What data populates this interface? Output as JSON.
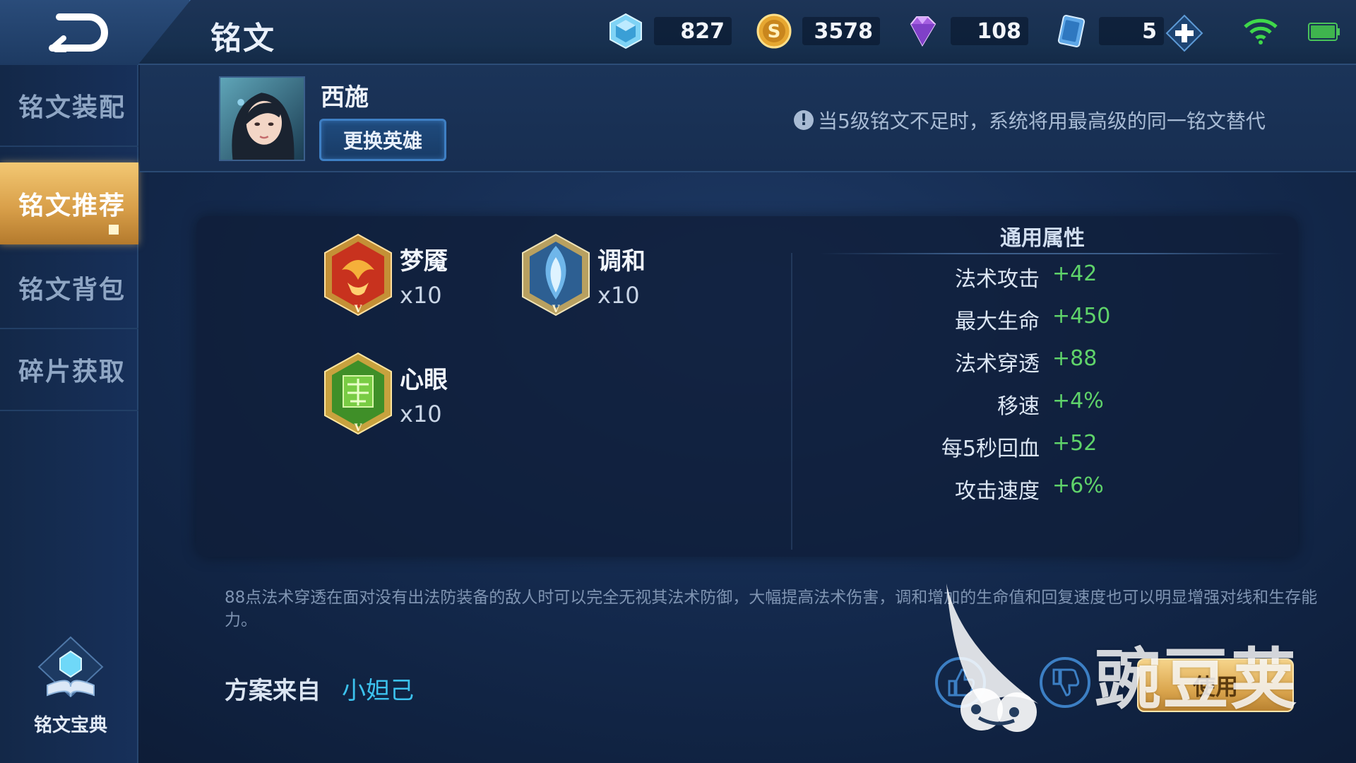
{
  "header": {
    "title": "铭文",
    "currencies": [
      {
        "icon": "crystal-icon",
        "value": "827"
      },
      {
        "icon": "gold-coin-icon",
        "value": "3578"
      },
      {
        "icon": "diamond-icon",
        "value": "108"
      },
      {
        "icon": "card-icon",
        "value": "5"
      }
    ]
  },
  "sidebar": {
    "items": [
      {
        "label": "铭文装配",
        "active": false
      },
      {
        "label": "铭文推荐",
        "active": true
      },
      {
        "label": "铭文背包",
        "active": false
      },
      {
        "label": "碎片获取",
        "active": false
      }
    ],
    "codex_label": "铭文宝典"
  },
  "hero": {
    "name": "西施",
    "change_button": "更换英雄",
    "notice": "当5级铭文不足时，系统将用最高级的同一铭文替代"
  },
  "runes": [
    {
      "name": "梦魇",
      "count": "x10",
      "color": "#c8321e",
      "icon": "nightmare-rune-icon"
    },
    {
      "name": "调和",
      "count": "x10",
      "color": "#4a8fd0",
      "icon": "harmony-rune-icon"
    },
    {
      "name": "心眼",
      "count": "x10",
      "color": "#4fa32a",
      "icon": "mind-eye-rune-icon"
    }
  ],
  "attributes": {
    "title": "通用属性",
    "rows": [
      {
        "label": "法术攻击",
        "value": "+42"
      },
      {
        "label": "最大生命",
        "value": "+450"
      },
      {
        "label": "法术穿透",
        "value": "+88"
      },
      {
        "label": "移速",
        "value": "+4%"
      },
      {
        "label": "每5秒回血",
        "value": "+52"
      },
      {
        "label": "攻击速度",
        "value": "+6%"
      }
    ]
  },
  "description": "88点法术穿透在面对没有出法防装备的敌人时可以完全无视其法术防御，大幅提高法术伤害，调和增加的生命值和回复速度也可以明显增强对线和生存能力。",
  "source": {
    "label": "方案来自",
    "author": "小妲己"
  },
  "actions": {
    "use_button": "使用"
  },
  "watermark": "豌豆荚",
  "colors": {
    "accent_gold": "#e0a850",
    "value_green": "#5fd36a",
    "author_blue": "#3cc2ee"
  }
}
